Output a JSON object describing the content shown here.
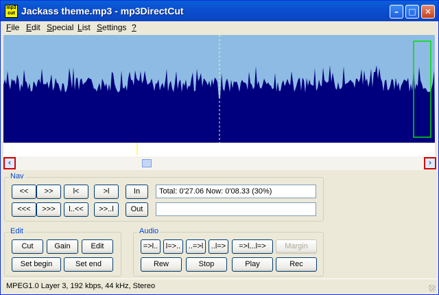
{
  "window": {
    "title": "Jackass theme.mp3 - mp3DirectCut",
    "icon_text": "mp3 cut"
  },
  "titlebar_buttons": {
    "minimize": "–",
    "maximize": "□",
    "close": "✕"
  },
  "menu": [
    {
      "label": "File",
      "ul": "F",
      "rest": "ile"
    },
    {
      "label": "Edit",
      "ul": "E",
      "rest": "dit"
    },
    {
      "label": "Special",
      "ul": "S",
      "rest": "pecial"
    },
    {
      "label": "List",
      "ul": "L",
      "rest": "ist"
    },
    {
      "label": "Settings",
      "ul": "S",
      "rest": "ettings"
    },
    {
      "label": "?",
      "ul": "?",
      "rest": ""
    }
  ],
  "colors": {
    "waveform_bg": "#8ebbe3",
    "waveform_fill": "#00007f",
    "cursor": "#ffff66",
    "selection_box": "#00e000",
    "scroll_highlight": "#d40000"
  },
  "scrollbar": {
    "left_arrow": "‹",
    "right_arrow": "›",
    "position_fraction": 0.3
  },
  "playback": {
    "position_fraction": 0.3
  },
  "nav": {
    "label": "Nav",
    "row1": [
      "<<",
      ">>",
      "l<",
      ">l"
    ],
    "row2": [
      "<<<",
      ">>>",
      "l..<<",
      ">>..l"
    ],
    "in_label": "In",
    "out_label": "Out",
    "info_text": "Total: 0'27.06   Now: 0'08.33  (30%)",
    "secondary_text": ""
  },
  "edit": {
    "label": "Edit",
    "cut": "Cut",
    "gain": "Gain",
    "edit": "Edit",
    "set_begin": "Set begin",
    "set_end": "Set end"
  },
  "audio": {
    "label": "Audio",
    "row1": [
      "=>l..",
      "l=>..",
      "..=>l",
      "..l=>",
      "=>l...l=>"
    ],
    "margin": "Margin",
    "rew": "Rew",
    "stop": "Stop",
    "play": "Play",
    "rec": "Rec"
  },
  "status": "MPEG1.0 Layer 3, 192 kbps, 44 kHz, Stereo"
}
